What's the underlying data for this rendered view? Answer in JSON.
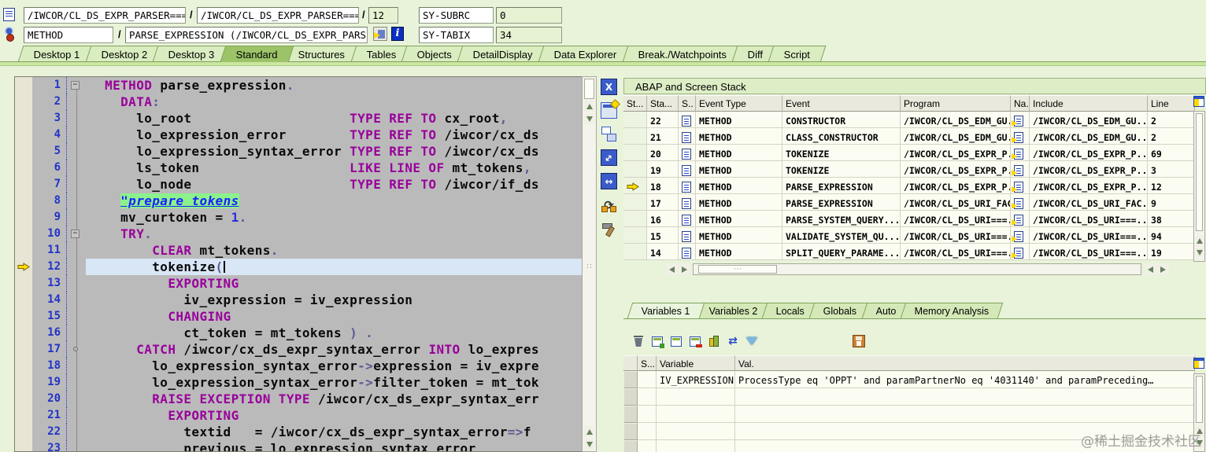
{
  "header": {
    "separator": "/",
    "main_program": "/IWCOR/CL_DS_EXPR_PARSER=====...",
    "source_program": "/IWCOR/CL_DS_EXPR_PARSER=====...",
    "line_number": "12",
    "sy_subrc_label": "SY-SUBRC",
    "sy_subrc_value": "0",
    "event_type": "METHOD",
    "event_name": "PARSE_EXPRESSION (/IWCOR/CL_DS_EXPR_PARSER)",
    "sy_tabix_label": "SY-TABIX",
    "sy_tabix_value": "34",
    "icons": [
      "program-icon",
      "debugger-icon",
      "goto-statement-icon",
      "info-icon"
    ]
  },
  "main_tabs": {
    "active": "Standard",
    "items": [
      "Desktop 1",
      "Desktop 2",
      "Desktop 3",
      "Standard",
      "Structures",
      "Tables",
      "Objects",
      "DetailDisplay",
      "Data Explorer",
      "Break./Watchpoints",
      "Diff",
      "Script"
    ]
  },
  "editor": {
    "current_line": 12,
    "lines": [
      {
        "n": 1,
        "mark": "fold-half",
        "seg": [
          [
            "si",
            "  "
          ],
          [
            "sk",
            "METHOD"
          ],
          [
            "si",
            " parse_expression"
          ],
          [
            "sp",
            "."
          ]
        ]
      },
      {
        "n": 2,
        "mark": "vl",
        "seg": [
          [
            "si",
            "    "
          ],
          [
            "sk",
            "DATA"
          ],
          [
            "sp",
            ":"
          ]
        ]
      },
      {
        "n": 3,
        "mark": "vl",
        "seg": [
          [
            "si",
            "      lo_root                    "
          ],
          [
            "sk",
            "TYPE REF TO"
          ],
          [
            "si",
            " cx_root"
          ],
          [
            "sp",
            ","
          ]
        ]
      },
      {
        "n": 4,
        "mark": "vl",
        "seg": [
          [
            "si",
            "      lo_expression_error        "
          ],
          [
            "sk",
            "TYPE REF TO"
          ],
          [
            "si",
            " /iwcor/cx_ds"
          ]
        ]
      },
      {
        "n": 5,
        "mark": "vl",
        "seg": [
          [
            "si",
            "      lo_expression_syntax_error "
          ],
          [
            "sk",
            "TYPE REF TO"
          ],
          [
            "si",
            " /iwcor/cx_ds"
          ]
        ]
      },
      {
        "n": 6,
        "mark": "vl",
        "seg": [
          [
            "si",
            "      ls_token                   "
          ],
          [
            "sk",
            "LIKE LINE OF"
          ],
          [
            "si",
            " mt_tokens"
          ],
          [
            "sp",
            ","
          ]
        ]
      },
      {
        "n": 7,
        "mark": "vl",
        "seg": [
          [
            "si",
            "      lo_node                    "
          ],
          [
            "sk",
            "TYPE REF TO"
          ],
          [
            "si",
            " /iwcor/if_ds"
          ]
        ]
      },
      {
        "n": 8,
        "mark": "vl",
        "seg": [
          [
            "si",
            "    "
          ],
          [
            "scm",
            "\"prepare tokens"
          ]
        ]
      },
      {
        "n": 9,
        "mark": "vl",
        "seg": [
          [
            "si",
            "    mv_curtoken = "
          ],
          [
            "sn",
            "1"
          ],
          [
            "sp",
            "."
          ]
        ]
      },
      {
        "n": 10,
        "mark": "fold",
        "seg": [
          [
            "si",
            "    "
          ],
          [
            "sk",
            "TRY"
          ],
          [
            "sp",
            "."
          ]
        ]
      },
      {
        "n": 11,
        "mark": "vl",
        "seg": [
          [
            "si",
            "        "
          ],
          [
            "sk",
            "CLEAR"
          ],
          [
            "si",
            " mt_tokens"
          ],
          [
            "sp",
            "."
          ]
        ]
      },
      {
        "n": 12,
        "mark": "vl",
        "caret": true,
        "seg": [
          [
            "si",
            "        tokenize"
          ],
          [
            "sp",
            "("
          ]
        ]
      },
      {
        "n": 13,
        "mark": "vl",
        "seg": [
          [
            "si",
            "          "
          ],
          [
            "sk",
            "EXPORTING"
          ]
        ]
      },
      {
        "n": 14,
        "mark": "vl",
        "seg": [
          [
            "si",
            "            iv_expression = iv_expression"
          ]
        ]
      },
      {
        "n": 15,
        "mark": "vl",
        "seg": [
          [
            "si",
            "          "
          ],
          [
            "sk",
            "CHANGING"
          ]
        ]
      },
      {
        "n": 16,
        "mark": "vl",
        "seg": [
          [
            "si",
            "            ct_token = mt_tokens "
          ],
          [
            "sp",
            ") ."
          ]
        ]
      },
      {
        "n": 17,
        "mark": "circle",
        "seg": [
          [
            "si",
            "      "
          ],
          [
            "sk",
            "CATCH"
          ],
          [
            "si",
            " /iwcor/cx_ds_expr_syntax_error "
          ],
          [
            "sk",
            "INTO"
          ],
          [
            "si",
            " lo_expres"
          ]
        ]
      },
      {
        "n": 18,
        "mark": "vl",
        "seg": [
          [
            "si",
            "        lo_expression_syntax_error"
          ],
          [
            "sp",
            "->"
          ],
          [
            "si",
            "expression = iv_expre"
          ]
        ]
      },
      {
        "n": 19,
        "mark": "vl",
        "seg": [
          [
            "si",
            "        lo_expression_syntax_error"
          ],
          [
            "sp",
            "->"
          ],
          [
            "si",
            "filter_token = mt_tok"
          ]
        ]
      },
      {
        "n": 20,
        "mark": "vl",
        "seg": [
          [
            "si",
            "        "
          ],
          [
            "sk",
            "RAISE EXCEPTION TYPE"
          ],
          [
            "si",
            " /iwcor/cx_ds_expr_syntax_err"
          ]
        ]
      },
      {
        "n": 21,
        "mark": "vl",
        "seg": [
          [
            "si",
            "          "
          ],
          [
            "sk",
            "EXPORTING"
          ]
        ]
      },
      {
        "n": 22,
        "mark": "vl",
        "seg": [
          [
            "si",
            "            textid   = /iwcor/cx_ds_expr_syntax_error"
          ],
          [
            "sp",
            "=>"
          ],
          [
            "si",
            "f"
          ]
        ]
      },
      {
        "n": 23,
        "mark": "vl",
        "seg": [
          [
            "si",
            "            previous = lo_expression_syntax_error"
          ]
        ]
      }
    ]
  },
  "editor_toolbar": {
    "icons": [
      "close-icon",
      "new-session-icon",
      "swap-windows-icon",
      "maximize-icon",
      "fit-width-icon",
      "refresh-layout-icon",
      "configure-tool-icon"
    ]
  },
  "stack": {
    "title": "ABAP and Screen Stack",
    "columns": [
      "St...",
      "Sta...",
      "S..",
      "Event Type",
      "Event",
      "Program",
      "Na...",
      "Include",
      "Line"
    ],
    "current_level": "18",
    "rows": [
      {
        "level": "22",
        "event_type": "METHOD",
        "event": "CONSTRUCTOR",
        "program": "/IWCOR/CL_DS_EDM_GU..",
        "include": "/IWCOR/CL_DS_EDM_GU..",
        "line": "2"
      },
      {
        "level": "21",
        "event_type": "METHOD",
        "event": "CLASS_CONSTRUCTOR",
        "program": "/IWCOR/CL_DS_EDM_GU..",
        "include": "/IWCOR/CL_DS_EDM_GU..",
        "line": "2"
      },
      {
        "level": "20",
        "event_type": "METHOD",
        "event": "TOKENIZE",
        "program": "/IWCOR/CL_DS_EXPR_P...",
        "include": "/IWCOR/CL_DS_EXPR_P...",
        "line": "69"
      },
      {
        "level": "19",
        "event_type": "METHOD",
        "event": "TOKENIZE",
        "program": "/IWCOR/CL_DS_EXPR_P...",
        "include": "/IWCOR/CL_DS_EXPR_P...",
        "line": "3"
      },
      {
        "level": "18",
        "event_type": "METHOD",
        "event": "PARSE_EXPRESSION",
        "program": "/IWCOR/CL_DS_EXPR_P...",
        "include": "/IWCOR/CL_DS_EXPR_P...",
        "line": "12"
      },
      {
        "level": "17",
        "event_type": "METHOD",
        "event": "PARSE_EXPRESSION",
        "program": "/IWCOR/CL_DS_URI_FAC..",
        "include": "/IWCOR/CL_DS_URI_FAC..",
        "line": "9"
      },
      {
        "level": "16",
        "event_type": "METHOD",
        "event": "PARSE_SYSTEM_QUERY...",
        "program": "/IWCOR/CL_DS_URI===...",
        "include": "/IWCOR/CL_DS_URI===...",
        "line": "38"
      },
      {
        "level": "15",
        "event_type": "METHOD",
        "event": "VALIDATE_SYSTEM_QU...",
        "program": "/IWCOR/CL_DS_URI===...",
        "include": "/IWCOR/CL_DS_URI===...",
        "line": "94"
      },
      {
        "level": "14",
        "event_type": "METHOD",
        "event": "SPLIT_QUERY_PARAME...",
        "program": "/IWCOR/CL_DS_URI===...",
        "include": "/IWCOR/CL_DS_URI===...",
        "line": "19"
      }
    ]
  },
  "variables": {
    "tabs": [
      "Variables 1",
      "Variables 2",
      "Locals",
      "Globals",
      "Auto",
      "Memory Analysis"
    ],
    "active_tab": "Variables 1",
    "toolbar_icons": [
      "delete-icon",
      "table-create-icon",
      "table-view-icon",
      "table-remove-icon",
      "sort-columns-icon",
      "swap-icon",
      "filter-icon"
    ],
    "save_icon": "save-icon",
    "columns": [
      "",
      "S...",
      "Variable",
      "Val."
    ],
    "rows": [
      {
        "variable": "IV_EXPRESSION",
        "value": "ProcessType eq 'OPPT' and paramPartnerNo eq '4031140' and paramPreceding…"
      }
    ],
    "empty_row_count": 4
  },
  "watermark": "@稀土掘金技术社区"
}
